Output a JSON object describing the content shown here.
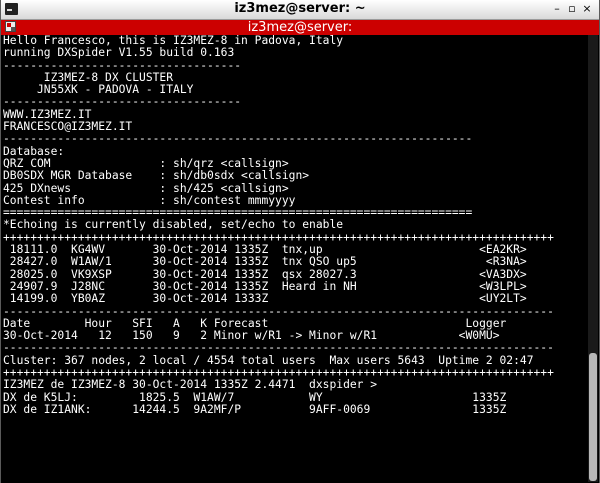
{
  "window": {
    "title": "iz3mez@server: ~",
    "tab_label": "iz3mez@server:",
    "buttons": {
      "minimize": "–",
      "restore": "▫",
      "close": "×"
    },
    "icons": {
      "app": "terminal-icon",
      "tab": "terminal-tab-icon"
    }
  },
  "terminal": {
    "lines": [
      "Hello Francesco, this is IZ3MEZ-8 in Padova, Italy",
      "running DXSpider V1.55 build 0.163",
      "-----------------------------------",
      "      IZ3MEZ-8 DX CLUSTER",
      "     JN55XK - PADOVA - ITALY",
      "-----------------------------------",
      "WWW.IZ3MEZ.IT",
      "FRANCESCO@IZ3MEZ.IT",
      "---------------------------------------------------------------------",
      "Database:",
      "QRZ COM                : sh/qrz <callsign>",
      "DB0SDX MGR Database    : sh/db0sdx <callsign>",
      "425 DXnews             : sh/425 <callsign>",
      "Contest info           : sh/contest mmmyyyy",
      "=====================================================================",
      "*Echoing is currently disabled, set/echo to enable",
      "+++++++++++++++++++++++++++++++++++++++++++++++++++++++++++++++++++++++++++++++++",
      " 18111.0  KG4WV       30-Oct-2014 1335Z  tnx,up                       <EA2KR>",
      " 28427.0  W1AW/1      30-Oct-2014 1335Z  tnx QSO up5                   <R3NA>",
      " 28025.0  VK9XSP      30-Oct-2014 1335Z  qsx 28027.3                  <VA3DX>",
      " 24907.9  J28NC       30-Oct-2014 1335Z  Heard in NH                  <W3LPL>",
      " 14199.0  YB0AZ       30-Oct-2014 1333Z                               <UY2LT>",
      "---------------------------------------------------------------------------------",
      "Date        Hour   SFI   A   K Forecast                             Logger",
      "30-Oct-2014   12   150   9   2 Minor w/R1 -> Minor w/R1            <W0MU>",
      "---------------------------------------------------------------------------------",
      "Cluster: 367 nodes, 2 local / 4554 total users  Max users 5643  Uptime 2 02:47",
      "+++++++++++++++++++++++++++++++++++++++++++++++++++++++++++++++++++++++++++++++++",
      "IZ3MEZ de IZ3MEZ-8 30-Oct-2014 1335Z 2.4471  dxspider >",
      "DX de K5LJ:         1825.5  W1AW/7           WY                      1335Z",
      "DX de IZ1ANK:      14244.5  9A2MF/P          9AFF-0069               1335Z"
    ]
  },
  "colors": {
    "terminal_bg": "#000000",
    "terminal_fg": "#ffffff",
    "tab_bar": "#cc0000"
  }
}
